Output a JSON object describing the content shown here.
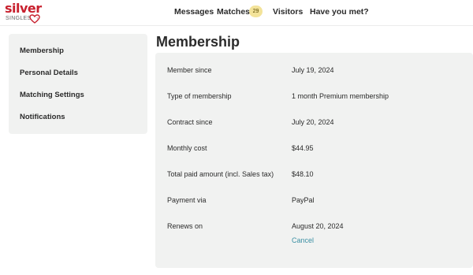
{
  "brand": {
    "name": "silver",
    "subname": "SINGLES",
    "color": "#c8202e"
  },
  "nav": {
    "messages": "Messages",
    "matches": "Matches",
    "matches_badge": "29",
    "visitors": "Visitors",
    "have_you_met": "Have you met?"
  },
  "sidebar": {
    "items": [
      {
        "label": "Membership"
      },
      {
        "label": "Personal Details"
      },
      {
        "label": "Matching Settings"
      },
      {
        "label": "Notifications"
      }
    ]
  },
  "main": {
    "title": "Membership",
    "rows": [
      {
        "label": "Member since",
        "value": "July 19, 2024"
      },
      {
        "label": "Type of membership",
        "value": "1 month Premium membership"
      },
      {
        "label": "Contract since",
        "value": "July 20, 2024"
      },
      {
        "label": "Monthly cost",
        "value": "$44.95"
      },
      {
        "label": "Total paid amount (incl. Sales tax)",
        "value": "$48.10"
      },
      {
        "label": "Payment via",
        "value": "PayPal"
      },
      {
        "label": "Renews on",
        "value": "August 20, 2024"
      }
    ],
    "cancel_label": "Cancel",
    "link_color": "#3a8fa3"
  }
}
